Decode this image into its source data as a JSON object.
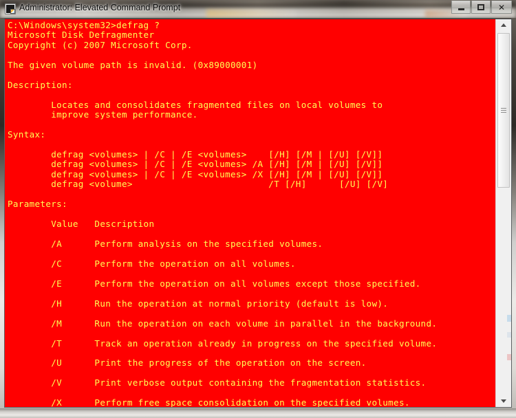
{
  "window": {
    "title": "Administrator: Elevated Command Prompt",
    "icon": "command-prompt-icon",
    "minimize_label": "–",
    "maximize_label": "□",
    "close_label": "✕"
  },
  "colors": {
    "console_background": "#FF0000",
    "console_foreground": "#FFFF55",
    "titlebar_text": "#0A0A0A"
  },
  "console": {
    "prompt_line": "C:\\Windows\\system32>defrag ?",
    "product_name": "Microsoft Disk Defragmenter",
    "copyright": "Copyright (c) 2007 Microsoft Corp.",
    "error_message": "The given volume path is invalid. (0x89000001)",
    "error_code": "0x89000001",
    "description_heading": "Description:",
    "description_lines": [
      "Locates and consolidates fragmented files on local volumes to",
      "improve system performance."
    ],
    "syntax_heading": "Syntax:",
    "syntax_lines": [
      "defrag <volumes> | /C | /E <volumes>    [/H] [/M | [/U] [/V]]",
      "defrag <volumes> | /C | /E <volumes> /A [/H] [/M | [/U] [/V]]",
      "defrag <volumes> | /C | /E <volumes> /X [/H] [/M | [/U] [/V]]",
      "defrag <volume>                         /T [/H]      [/U] [/V]"
    ],
    "parameters_heading": "Parameters:",
    "parameters_columns": [
      "Value",
      "Description"
    ],
    "parameters": [
      {
        "value": "/A",
        "description": "Perform analysis on the specified volumes."
      },
      {
        "value": "/C",
        "description": "Perform the operation on all volumes."
      },
      {
        "value": "/E",
        "description": "Perform the operation on all volumes except those specified."
      },
      {
        "value": "/H",
        "description": "Run the operation at normal priority (default is low)."
      },
      {
        "value": "/M",
        "description": "Run the operation on each volume in parallel in the background."
      },
      {
        "value": "/T",
        "description": "Track an operation already in progress on the specified volume."
      },
      {
        "value": "/U",
        "description": "Print the progress of the operation on the screen."
      },
      {
        "value": "/V",
        "description": "Print verbose output containing the fragmentation statistics."
      },
      {
        "value": "/X",
        "description": "Perform free space consolidation on the specified volumes."
      }
    ],
    "full_text": "C:\\Windows\\system32>defrag ?\nMicrosoft Disk Defragmenter\nCopyright (c) 2007 Microsoft Corp.\n\nThe given volume path is invalid. (0x89000001)\n\nDescription:\n\n        Locates and consolidates fragmented files on local volumes to\n        improve system performance.\n\nSyntax:\n\n        defrag <volumes> | /C | /E <volumes>    [/H] [/M | [/U] [/V]]\n        defrag <volumes> | /C | /E <volumes> /A [/H] [/M | [/U] [/V]]\n        defrag <volumes> | /C | /E <volumes> /X [/H] [/M | [/U] [/V]]\n        defrag <volume>                         /T [/H]      [/U] [/V]\n\nParameters:\n\n        Value   Description\n\n        /A      Perform analysis on the specified volumes.\n\n        /C      Perform the operation on all volumes.\n\n        /E      Perform the operation on all volumes except those specified.\n\n        /H      Run the operation at normal priority (default is low).\n\n        /M      Run the operation on each volume in parallel in the background.\n\n        /T      Track an operation already in progress on the specified volume.\n\n        /U      Print the progress of the operation on the screen.\n\n        /V      Print verbose output containing the fragmentation statistics.\n\n        /X      Perform free space consolidation on the specified volumes."
  },
  "scrollbar": {
    "up_arrow": "scroll-up",
    "down_arrow": "scroll-down",
    "orientation": "vertical"
  }
}
